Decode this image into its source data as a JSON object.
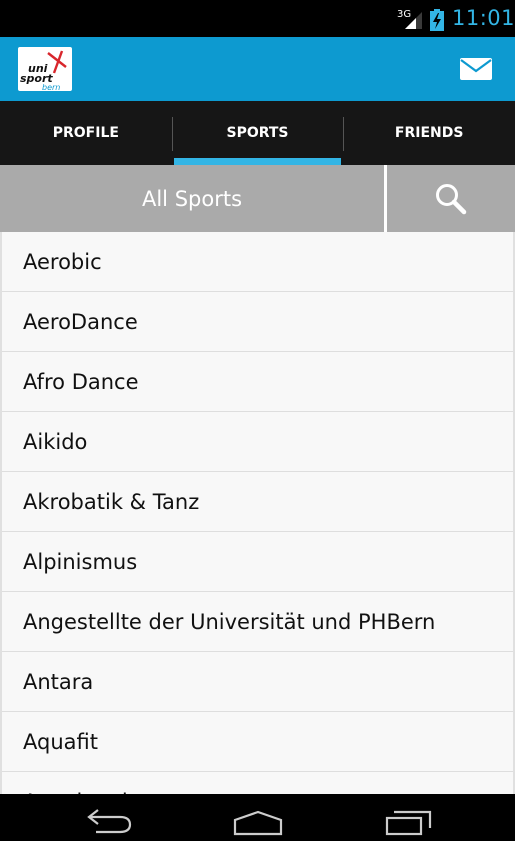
{
  "status_bar": {
    "network": "3G",
    "time": "11:01"
  },
  "action_bar": {
    "logo_text_top": "uni",
    "logo_text_mid": "sport",
    "logo_text_bottom": "bern",
    "brand_color": "#0d9ad0"
  },
  "tabs": [
    {
      "label": "PROFILE",
      "selected": false
    },
    {
      "label": "SPORTS",
      "selected": true
    },
    {
      "label": "FRIENDS",
      "selected": false
    }
  ],
  "filter": {
    "label": "All Sports"
  },
  "sports": [
    "Aerobic",
    "AeroDance",
    "Afro Dance",
    "Aikido",
    "Akrobatik & Tanz",
    "Alpinismus",
    "Angestellte der Universität und PHBern",
    "Antara",
    "Aquafit",
    "Aquajogging"
  ],
  "colors": {
    "accent": "#33b5e5",
    "tab_bg": "#161616",
    "filter_bg": "#aaaaaa"
  }
}
